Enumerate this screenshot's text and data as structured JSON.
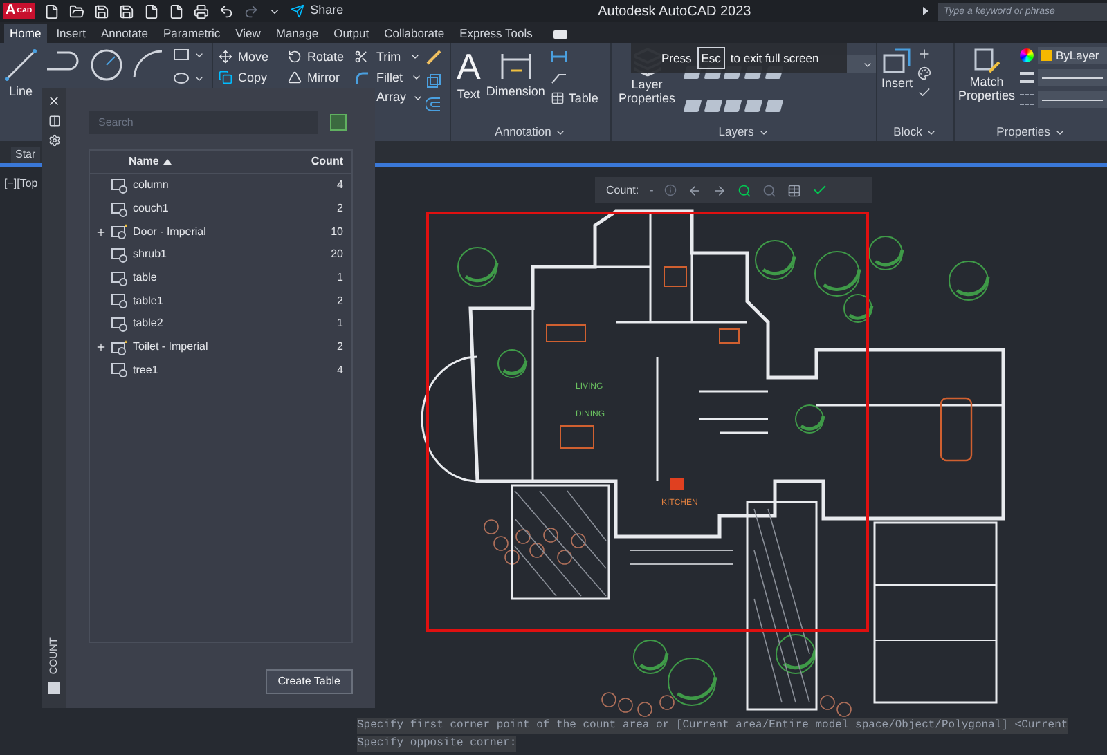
{
  "title_bar": {
    "logo": "A",
    "logo_badge": "CAD",
    "share": "Share",
    "title": "Autodesk AutoCAD 2023",
    "search_placeholder": "Type a keyword or phrase"
  },
  "tabs": [
    {
      "label": "Home",
      "selected": true
    },
    {
      "label": "Insert",
      "selected": false
    },
    {
      "label": "Annotate",
      "selected": false
    },
    {
      "label": "Parametric",
      "selected": false
    },
    {
      "label": "View",
      "selected": false
    },
    {
      "label": "Manage",
      "selected": false
    },
    {
      "label": "Output",
      "selected": false
    },
    {
      "label": "Collaborate",
      "selected": false
    },
    {
      "label": "Express Tools",
      "selected": false
    }
  ],
  "ribbon": {
    "draw": {
      "line": "Line"
    },
    "modify": {
      "move": "Move",
      "copy": "Copy",
      "rotate": "Rotate",
      "mirror": "Mirror",
      "trim": "Trim",
      "fillet": "Fillet",
      "array": "Array"
    },
    "annotation": {
      "title": "Annotation",
      "text_glyph": "A",
      "text": "Text",
      "dimension": "Dimension",
      "table": "Table"
    },
    "layers": {
      "title": "Layers",
      "layer_properties": "Layer Properties"
    },
    "block": {
      "title": "Block",
      "insert": "Insert"
    },
    "properties": {
      "title": "Properties",
      "match_properties": "Match Properties",
      "layer_color_label": "ByLayer"
    }
  },
  "fullscreen_notice": {
    "before": "Press",
    "key": "Esc",
    "after": "to exit full screen"
  },
  "file_tab": "Star",
  "viewport_label": "[−][Top",
  "count_toolbar": {
    "label": "Count:",
    "dropdown": "-"
  },
  "drawing_labels": {
    "living": "LIVING",
    "dining": "DINING",
    "kitchen": "KITCHEN"
  },
  "count_palette": {
    "title": "COUNT",
    "search_placeholder": "Search",
    "columns": [
      {
        "label": "Name",
        "sorted": true
      },
      {
        "label": "Count",
        "sorted": false
      }
    ],
    "rows": [
      {
        "kind": "block",
        "expandable": false,
        "name": "column",
        "count": "4"
      },
      {
        "kind": "block",
        "expandable": false,
        "name": "couch1",
        "count": "2"
      },
      {
        "kind": "dynamic",
        "expandable": true,
        "name": "Door - Imperial",
        "count": "10"
      },
      {
        "kind": "block",
        "expandable": false,
        "name": "shrub1",
        "count": "20"
      },
      {
        "kind": "block",
        "expandable": false,
        "name": "table",
        "count": "1"
      },
      {
        "kind": "block",
        "expandable": false,
        "name": "table1",
        "count": "2"
      },
      {
        "kind": "block",
        "expandable": false,
        "name": "table2",
        "count": "1"
      },
      {
        "kind": "dynamic",
        "expandable": true,
        "name": "Toilet - Imperial",
        "count": "2"
      },
      {
        "kind": "block",
        "expandable": false,
        "name": "tree1",
        "count": "4"
      }
    ],
    "create_button": "Create Table"
  },
  "command_line": [
    "Specify first corner point of the count area or [Current area/Entire model space/Object/Polygonal] <Current",
    "Specify opposite corner:"
  ]
}
